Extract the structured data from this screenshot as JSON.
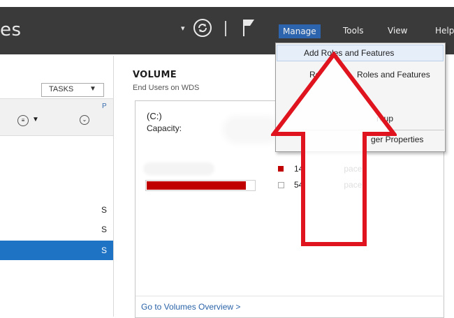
{
  "titlebar": {
    "app_title": "es",
    "dropdown_glyph": "▾",
    "menus": {
      "manage": "Manage",
      "tools": "Tools",
      "view": "View",
      "help": "Help"
    },
    "refresh_icon": "refresh-icon",
    "flag_icon": "flag-icon"
  },
  "left": {
    "tasks_label": "TASKS",
    "tasks_arrow": "▼",
    "col_p": "P",
    "rows": [
      "S",
      "S",
      "S"
    ]
  },
  "volume": {
    "title": "VOLUME",
    "subtitle": "End Users on WDS",
    "drive": "(C:)",
    "capacity_label": "Capacity:",
    "used_fraction": 0.92,
    "legend_used": "14",
    "legend_used_tail": "pace",
    "legend_free": "54",
    "legend_free_tail": "pace",
    "link": "Go to Volumes Overview >"
  },
  "manage_menu": {
    "items": [
      "Add Roles and Features",
      "Re",
      "Roles and Features",
      "roup",
      "ger Properties"
    ]
  },
  "colors": {
    "titlebar_bg": "#3a3a3a",
    "manage_active": "#2c65ad",
    "used": "#c00000",
    "selected_row": "#1f73c4",
    "arrow": "#e0141e"
  }
}
